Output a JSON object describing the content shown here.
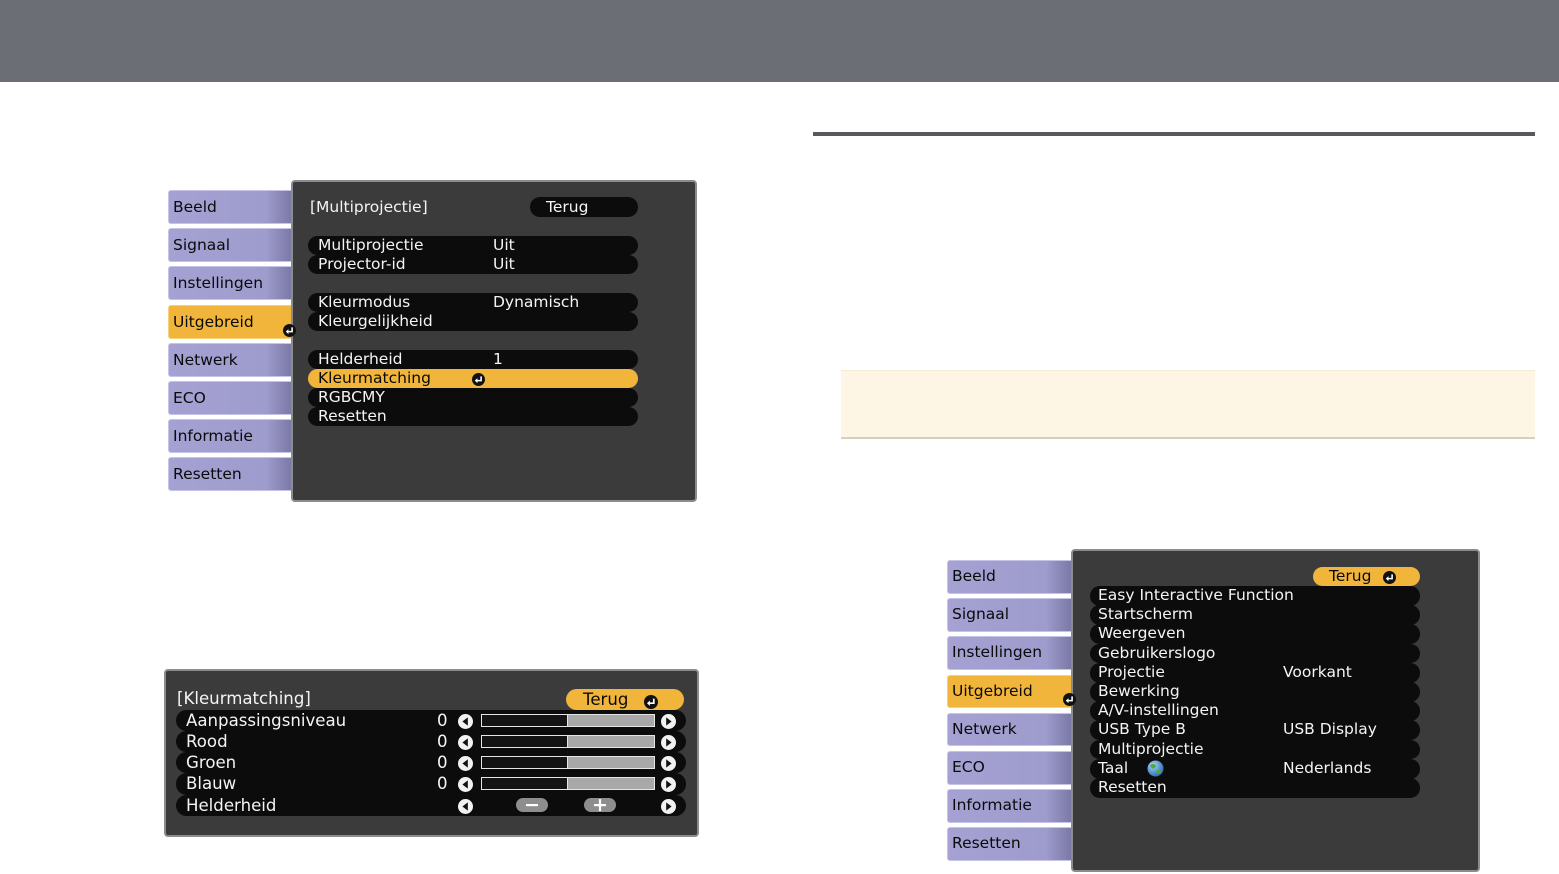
{
  "colors": {
    "header_bar": "#6b6e75",
    "tab_background": "#9e9bcd",
    "selected_highlight": "#f2b53c",
    "panel_background": "#3b3b3b",
    "panel_border": "#8c8c8c",
    "row_background": "#0c0c0c",
    "note_background": "#fef6e4",
    "divider": "#58595c"
  },
  "icons": {
    "enter": "enter-icon",
    "left_arrow": "arrow-left-icon",
    "right_arrow": "arrow-right-icon",
    "minus": "minus-icon",
    "plus": "plus-icon",
    "globe": "globe-icon"
  },
  "multiprojection_menu": {
    "tabs": [
      {
        "label": "Beeld"
      },
      {
        "label": "Signaal"
      },
      {
        "label": "Instellingen"
      },
      {
        "label": "Uitgebreid",
        "selected": true
      },
      {
        "label": "Netwerk"
      },
      {
        "label": "ECO"
      },
      {
        "label": "Informatie"
      },
      {
        "label": "Resetten"
      }
    ],
    "title": "[Multiprojectie]",
    "back_label": "Terug",
    "rows": [
      {
        "label": "Multiprojectie",
        "value": "Uit"
      },
      {
        "label": "Projector-id",
        "value": "Uit"
      },
      {
        "label": "Kleurmodus",
        "value": "Dynamisch"
      },
      {
        "label": "Kleurgelijkheid"
      },
      {
        "label": "Helderheid",
        "value": "1"
      },
      {
        "label": "Kleurmatching",
        "selected": true
      },
      {
        "label": "RGBCMY"
      },
      {
        "label": "Resetten"
      }
    ]
  },
  "color_matching_menu": {
    "title": "[Kleurmatching]",
    "back_label": "Terug",
    "rows": [
      {
        "label": "Aanpassingsniveau",
        "value": "0",
        "level": 0.5
      },
      {
        "label": "Rood",
        "value": "0",
        "level": 0.5
      },
      {
        "label": "Groen",
        "value": "0",
        "level": 0.5
      },
      {
        "label": "Blauw",
        "value": "0",
        "level": 0.5
      },
      {
        "label": "Helderheid"
      }
    ]
  },
  "extended_menu": {
    "tabs": [
      {
        "label": "Beeld"
      },
      {
        "label": "Signaal"
      },
      {
        "label": "Instellingen"
      },
      {
        "label": "Uitgebreid",
        "selected": true
      },
      {
        "label": "Netwerk"
      },
      {
        "label": "ECO"
      },
      {
        "label": "Informatie"
      },
      {
        "label": "Resetten"
      }
    ],
    "back_label": "Terug",
    "rows": [
      {
        "label": "Easy Interactive Function"
      },
      {
        "label": "Startscherm"
      },
      {
        "label": "Weergeven"
      },
      {
        "label": "Gebruikerslogo"
      },
      {
        "label": "Projectie",
        "value": "Voorkant"
      },
      {
        "label": "Bewerking"
      },
      {
        "label": "A/V-instellingen"
      },
      {
        "label": "USB Type B",
        "value": "USB Display"
      },
      {
        "label": "Multiprojectie"
      },
      {
        "label": "Taal",
        "value": "Nederlands",
        "icon": "globe-icon"
      },
      {
        "label": "Resetten"
      }
    ]
  }
}
